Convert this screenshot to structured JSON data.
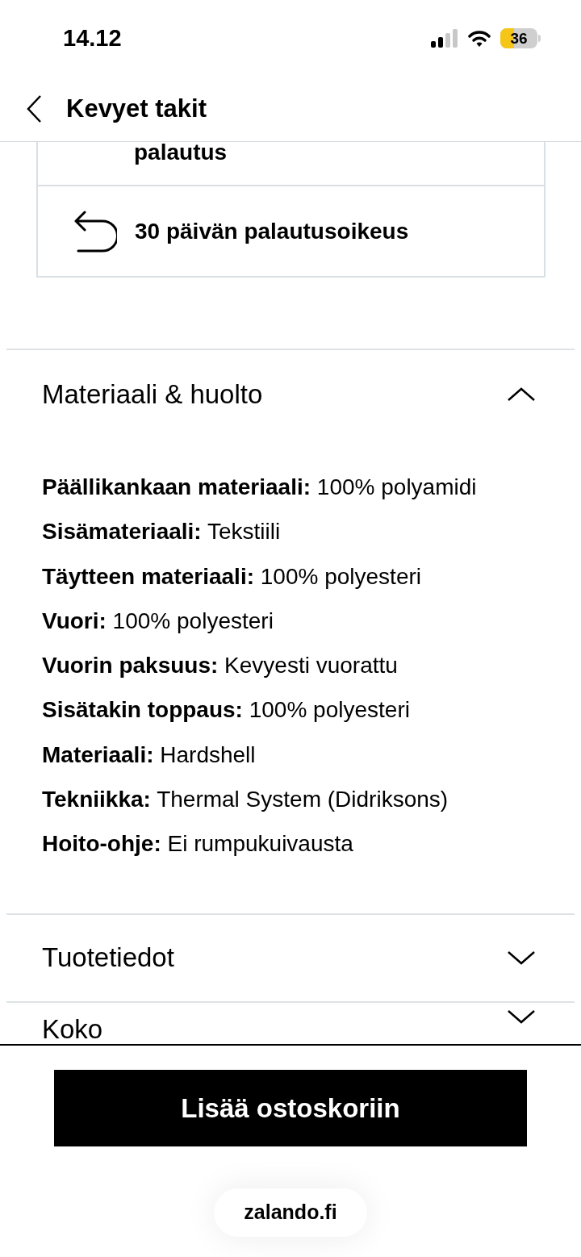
{
  "status_bar": {
    "time": "14.12",
    "battery": "36"
  },
  "header": {
    "title": "Kevyet takit"
  },
  "benefits": [
    {
      "kind": "text",
      "text": "palautus"
    },
    {
      "kind": "return",
      "text": "30 päivän palautusoikeus"
    }
  ],
  "sections": [
    {
      "title": "Materiaali & huolto",
      "expanded": true,
      "details": [
        "**Päällikankaan materiaali:** 100% polyamidi",
        "**Sisämateriaali:** Tekstiili",
        "**Täytteen materiaali:** 100% polyesteri",
        "**Vuori:** 100% polyesteri",
        "**Vuorin paksuus:** Kevyesti vuorattu",
        "**Sisätakin toppaus:** 100% polyesteri",
        "**Materiaali:** Hardshell",
        "**Tekniikka:** Thermal System (Didriksons)",
        "**Hoito-ohje:** Ei rumpukuivausta"
      ]
    },
    {
      "title": "Tuotetiedot",
      "expanded": false
    },
    {
      "title": "Koko",
      "expanded": false
    }
  ],
  "add_to_cart": "Lisää ostoskoriin",
  "url": "zalando.fi"
}
